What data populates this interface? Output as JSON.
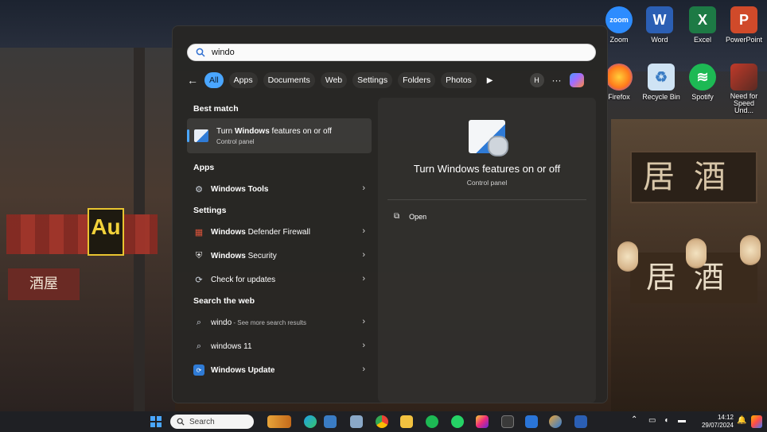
{
  "search": {
    "query": "windo",
    "filters": [
      "All",
      "Apps",
      "Documents",
      "Web",
      "Settings",
      "Folders",
      "Photos"
    ],
    "active_filter": "All",
    "avatar_initial": "H",
    "more": "···"
  },
  "results": {
    "best_match_heading": "Best match",
    "best_match": {
      "title_prefix": "Turn ",
      "title_bold": "Windows",
      "title_suffix": " features on or off",
      "subtitle": "Control panel"
    },
    "apps_heading": "Apps",
    "apps": [
      {
        "label": "Windows Tools",
        "icon": "tools-icon"
      }
    ],
    "settings_heading": "Settings",
    "settings": [
      {
        "prefix": "",
        "bold": "Windows",
        "suffix": " Defender Firewall",
        "icon": "firewall-icon"
      },
      {
        "prefix": "",
        "bold": "Windows",
        "suffix": " Security",
        "icon": "shield-icon"
      },
      {
        "prefix": "Check for updates",
        "bold": "",
        "suffix": "",
        "icon": "refresh-icon"
      }
    ],
    "web_heading": "Search the web",
    "web": [
      {
        "main": "windo",
        "sub": " - See more search results",
        "bold_main": false
      },
      {
        "main": "windows 11",
        "sub": "",
        "bold_main": true
      },
      {
        "main": "Windows Update",
        "sub": "",
        "bold_main": true
      }
    ]
  },
  "detail": {
    "title": "Turn Windows features on or off",
    "subtitle": "Control panel",
    "open_label": "Open"
  },
  "desktop_icons": [
    {
      "label": "Zoom",
      "color": "#2d8cff",
      "glyph": "zoom"
    },
    {
      "label": "Word",
      "color": "#2b5fb4",
      "glyph": "W"
    },
    {
      "label": "Excel",
      "color": "#1d7a45",
      "glyph": "X"
    },
    {
      "label": "PowerPoint",
      "color": "#d04a2a",
      "glyph": "P"
    },
    {
      "label": "Firefox",
      "color": "#ff7a1a",
      "glyph": ""
    },
    {
      "label": "Recycle Bin",
      "color": "#7fb6e6",
      "glyph": "♻"
    },
    {
      "label": "Spotify",
      "color": "#1db954",
      "glyph": ""
    },
    {
      "label": "Need for Speed Und...",
      "color": "#a03a2a",
      "glyph": ""
    }
  ],
  "taskbar": {
    "search_placeholder": "Search",
    "time": "14:12",
    "date": "29/07/2024"
  },
  "colors": {
    "accent": "#4aa6ff",
    "panel_bg": "#28262a",
    "taskbar_bg": "#1f2024"
  }
}
